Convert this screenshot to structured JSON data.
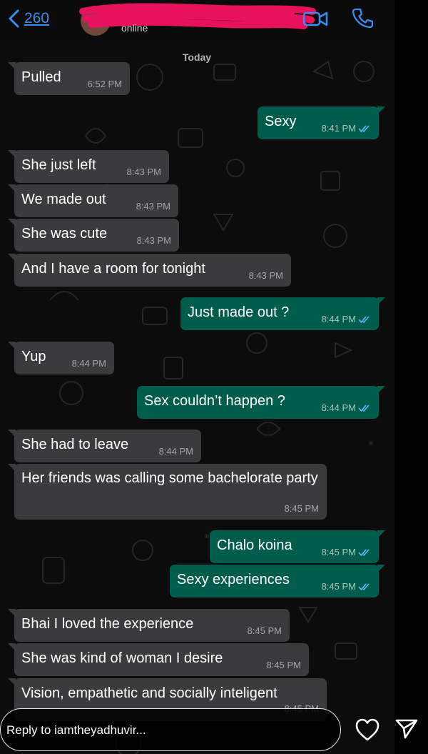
{
  "header": {
    "back_count": "260",
    "status": "online",
    "date_label": "Today"
  },
  "messages": [
    {
      "text": "Pulled",
      "time": "6:52 PM",
      "dir": "in"
    },
    {
      "text": "Sexy",
      "time": "8:41 PM",
      "dir": "out"
    },
    {
      "text": "She just left",
      "time": "8:43 PM",
      "dir": "in"
    },
    {
      "text": "We made out",
      "time": "8:43 PM",
      "dir": "in"
    },
    {
      "text": "She was cute",
      "time": "8:43 PM",
      "dir": "in"
    },
    {
      "text": "And I have a room for tonight",
      "time": "8:43 PM",
      "dir": "in"
    },
    {
      "text": "Just made out ?",
      "time": "8:44 PM",
      "dir": "out"
    },
    {
      "text": "Yup",
      "time": "8:44 PM",
      "dir": "in"
    },
    {
      "text": "Sex couldn’t happen ?",
      "time": "8:44 PM",
      "dir": "out"
    },
    {
      "text": "She had to leave",
      "time": "8:44 PM",
      "dir": "in"
    },
    {
      "text": "Her friends was calling some bachelorate party",
      "time": "8:45 PM",
      "dir": "in"
    },
    {
      "text": "Chalo koina",
      "time": "8:45 PM",
      "dir": "out"
    },
    {
      "text": "Sexy experiences",
      "time": "8:45 PM",
      "dir": "out"
    },
    {
      "text": "Bhai I loved the experience",
      "time": "8:45 PM",
      "dir": "in"
    },
    {
      "text": "She was kind of woman I desire",
      "time": "8:45 PM",
      "dir": "in"
    },
    {
      "text": "Vision, empathetic and socially inteligent",
      "time": "8:45 PM",
      "dir": "in"
    }
  ],
  "reply": {
    "placeholder": "Reply to iamtheyadhuvir..."
  },
  "colors": {
    "incoming_bubble": "#3a3b3c",
    "outgoing_bubble": "#005d4b",
    "read_ticks": "#5fb8ff",
    "link_blue": "#3b8cf0",
    "redaction": "#e8115e"
  }
}
